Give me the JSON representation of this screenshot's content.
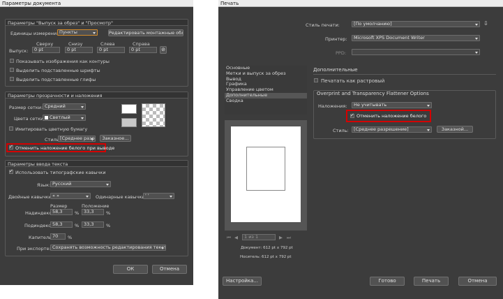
{
  "left": {
    "title": "Параметры документа",
    "bleed": {
      "header": "Параметры \"Выпуск за обрез\" и \"Просмотр\"",
      "units_label": "Единицы измерения:",
      "units_value": "Пункты",
      "edit_artboards": "Редактировать монтажные области",
      "bleed_label": "Выпуск:",
      "top_label": "Сверху",
      "bottom_label": "Снизу",
      "left_label": "Слева",
      "right_label": "Справа",
      "top": "0 pt",
      "bottom": "0 pt",
      "left": "0 pt",
      "right": "0 pt",
      "show_outline": "Показывать изображения как контуры",
      "highlight_fonts": "Выделить подставленные шрифты",
      "highlight_glyphs": "Выделить подставленные глифы"
    },
    "transp": {
      "header": "Параметры прозрачности и наложения",
      "grid_size_label": "Размер сетки:",
      "grid_size": "Средний",
      "grid_colors_label": "Цвета сетки:",
      "grid_colors": "Светлый",
      "simulate_paper": "Имитировать цветную бумагу",
      "style_label": "Стиль:",
      "style": "[Среднее разре...",
      "custom": "Заказное...",
      "discard_white": "Отменить наложение белого при выводе"
    },
    "text": {
      "header": "Параметры ввода текста",
      "typo_quotes": "Использовать типографские кавычки",
      "lang_label": "Язык:",
      "lang": "Русский",
      "double_label": "Двойные кавычки:",
      "double": "« »",
      "single_label": "Одинарные кавычки:",
      "single": "' '",
      "size_hdr": "Размер",
      "pos_hdr": "Положение",
      "super_label": "Надиндекс:",
      "super_size": "58,3",
      "super_pos": "33,3",
      "sub_label": "Подиндекс:",
      "sub_size": "58,3",
      "sub_pos": "33,3",
      "caps_label": "Капители:",
      "caps": "70",
      "pct": "%",
      "export_label": "При экспорте:",
      "export": "Сохранять возможность редактирования текста"
    },
    "ok": "ОК",
    "cancel": "Отмена"
  },
  "right": {
    "title": "Печать",
    "preset_label": "Стиль печати:",
    "preset": "[По умолчанию]",
    "printer_label": "Принтер:",
    "printer": "Microsoft XPS Document Writer",
    "ppd_label": "PPD:",
    "sidebar": [
      "Основные",
      "Метки и выпуск за обрез",
      "Вывод",
      "Графика",
      "Управление цветом",
      "Дополнительные",
      "Сводка"
    ],
    "section_title": "Дополнительные",
    "print_raster": "Печатать как растровый",
    "flat_header": "Overprint and Transparency Flattener Options",
    "overprint_label": "Наложения:",
    "overprint": "Не учитывать",
    "discard_white": "Отменить наложение белого",
    "style_label": "Стиль:",
    "style": "[Среднее разрешение]",
    "custom": "Заказной...",
    "page_nav": "1 из 1",
    "doc_size": "Документ: 612 pt x 792 pt",
    "media_size": "Носитель: 612 pt x 792 pt",
    "setup": "Настройка...",
    "done": "Готово",
    "print": "Печать",
    "cancel": "Отмена"
  }
}
